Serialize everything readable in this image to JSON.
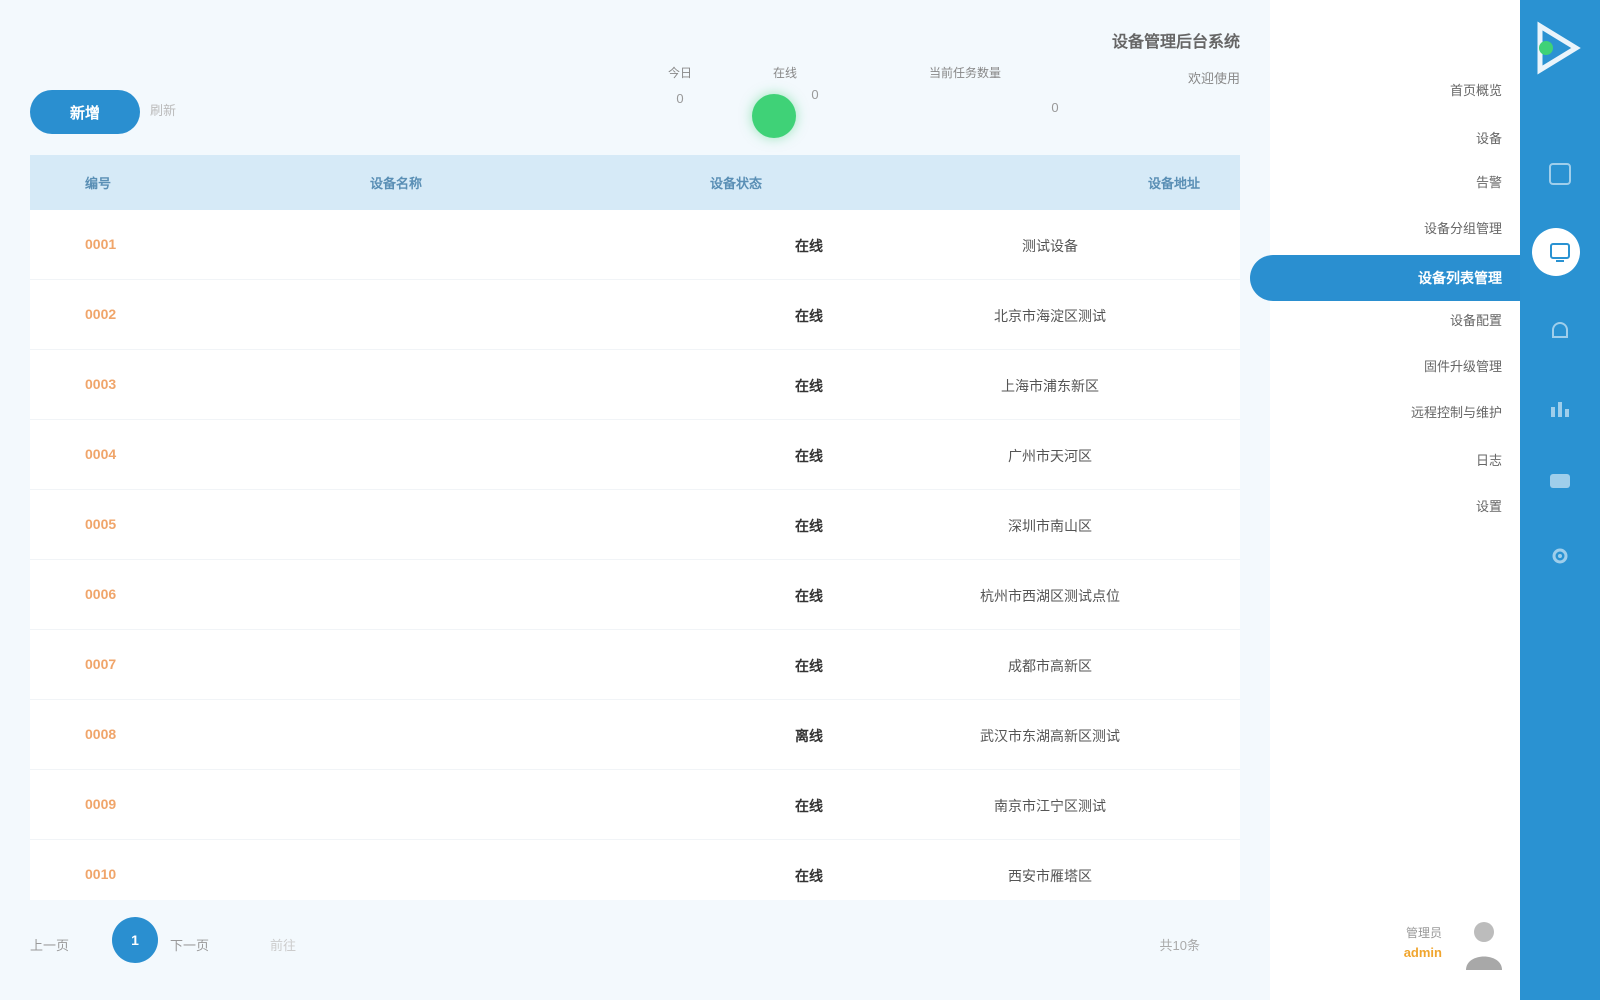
{
  "toolbar": {
    "primary_button": "新增",
    "aux_button": "刷新",
    "stats": [
      {
        "label": "今日",
        "value": "0"
      },
      {
        "label": "在线",
        "value": "0"
      },
      {
        "label": "当前任务数量",
        "value": ""
      },
      {
        "label": "",
        "value": "0"
      }
    ],
    "title": "设备管理后台系统",
    "subtitle": "欢迎使用"
  },
  "table": {
    "headers": [
      "编号",
      "设备名称",
      "设备状态",
      "设备地址"
    ],
    "rows": [
      {
        "code": "0001",
        "status": "在线",
        "address": "测试设备"
      },
      {
        "code": "0002",
        "status": "在线",
        "address": "北京市海淀区测试"
      },
      {
        "code": "0003",
        "status": "在线",
        "address": "上海市浦东新区"
      },
      {
        "code": "0004",
        "status": "在线",
        "address": "广州市天河区"
      },
      {
        "code": "0005",
        "status": "在线",
        "address": "深圳市南山区"
      },
      {
        "code": "0006",
        "status": "在线",
        "address": "杭州市西湖区测试点位"
      },
      {
        "code": "0007",
        "status": "在线",
        "address": "成都市高新区"
      },
      {
        "code": "0008",
        "status": "离线",
        "address": "武汉市东湖高新区测试"
      },
      {
        "code": "0009",
        "status": "在线",
        "address": "南京市江宁区测试"
      },
      {
        "code": "0010",
        "status": "在线",
        "address": "西安市雁塔区"
      }
    ]
  },
  "pagination": {
    "prev": "上一页",
    "current": "1",
    "next": "下一页",
    "jump": "前往",
    "total": "共10条"
  },
  "sidebar": {
    "items": [
      "首页概览",
      "设备",
      "告警",
      "设备分组管理",
      "设备列表管理",
      "设备配置",
      "固件升级管理",
      "远程控制与维护",
      "日志",
      "设置"
    ],
    "active_index": 4,
    "user_role": "管理员",
    "user_name": "admin"
  },
  "rail": {
    "icons": [
      "logo-icon",
      "home-icon",
      "device-icon",
      "alarm-icon",
      "chart-icon",
      "message-icon",
      "settings-icon"
    ]
  },
  "colors": {
    "accent": "#2a8fd0",
    "rail": "#2a92d2",
    "online": "#3fd277",
    "code_text": "#f0a56a",
    "header_bg": "#d6eaf7"
  }
}
